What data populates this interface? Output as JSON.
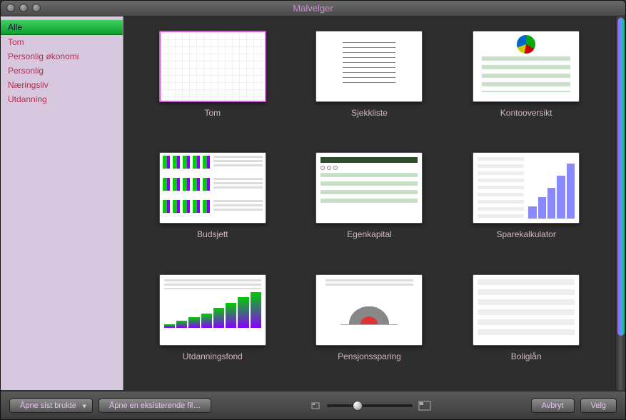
{
  "window": {
    "title": "Malvelger"
  },
  "sidebar": {
    "items": [
      {
        "label": "Alle",
        "selected": true
      },
      {
        "label": "Tom",
        "selected": false
      },
      {
        "label": "Personlig økonomi",
        "selected": false
      },
      {
        "label": "Personlig",
        "selected": false
      },
      {
        "label": "Næringsliv",
        "selected": false
      },
      {
        "label": "Utdanning",
        "selected": false
      }
    ]
  },
  "templates": [
    {
      "label": "Tom",
      "kind": "blank",
      "selected": true
    },
    {
      "label": "Sjekkliste",
      "kind": "checklist",
      "selected": false
    },
    {
      "label": "Kontooversikt",
      "kind": "account",
      "selected": false
    },
    {
      "label": "Budsjett",
      "kind": "budget",
      "selected": false
    },
    {
      "label": "Egenkapital",
      "kind": "equity",
      "selected": false
    },
    {
      "label": "Sparekalkulator",
      "kind": "savings",
      "selected": false
    },
    {
      "label": "Utdanningsfond",
      "kind": "edu",
      "selected": false
    },
    {
      "label": "Pensjonssparing",
      "kind": "pension",
      "selected": false
    },
    {
      "label": "Boliglån",
      "kind": "loan",
      "selected": false
    }
  ],
  "toolbar": {
    "open_recent": "Åpne sist brukte",
    "open_existing": "Åpne en eksisterende fil…",
    "cancel": "Avbryt",
    "choose": "Velg"
  }
}
